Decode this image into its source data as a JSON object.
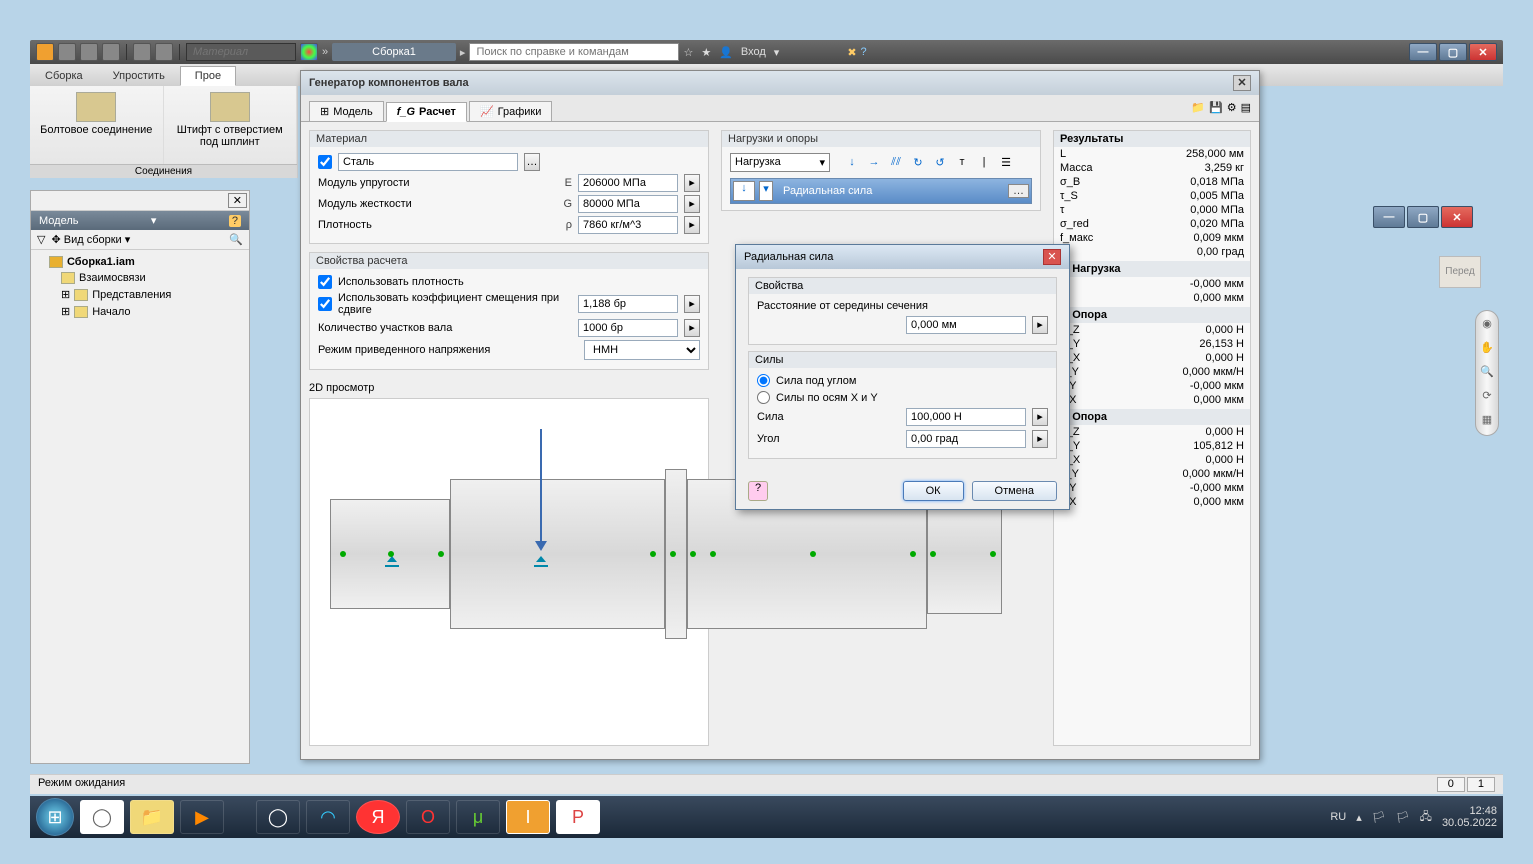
{
  "top": {
    "material_placeholder": "Материал",
    "doc_tab": "Сборка1",
    "search_placeholder": "Поиск по справке и командам",
    "login": "Вход"
  },
  "ribbon_tabs": [
    "Сборка",
    "Упростить",
    "Прое"
  ],
  "ribbon_items": {
    "bolt": "Болтовое соединение",
    "pin": "Штифт с отверстием под шплинт",
    "group": "Соединения"
  },
  "model_panel": {
    "title": "Модель",
    "filter": "Вид сборки",
    "root": "Сборка1.iam",
    "nodes": [
      "Взаимосвязи",
      "Представления",
      "Начало"
    ]
  },
  "gen": {
    "title": "Генератор компонентов вала",
    "tabs": {
      "model": "Модель",
      "calc": "Расчет",
      "graphs": "Графики"
    },
    "material": {
      "group": "Материал",
      "name": "Сталь",
      "e_label": "Модуль упругости",
      "e_sym": "E",
      "e_val": "206000 МПа",
      "g_label": "Модуль жесткости",
      "g_sym": "G",
      "g_val": "80000 МПа",
      "rho_label": "Плотность",
      "rho_sym": "ρ",
      "rho_val": "7860 кг/м^3"
    },
    "calc_props": {
      "group": "Свойства расчета",
      "use_density": "Использовать плотность",
      "use_shear": "Использовать коэффициент смещения при сдвиге",
      "shear_val": "1,188 бр",
      "sections_label": "Количество участков вала",
      "sections_val": "1000 бр",
      "mode_label": "Режим приведенного напряжения",
      "mode_val": "НМН"
    },
    "loads": {
      "group": "Нагрузки и опоры",
      "dd": "Нагрузка",
      "item": "Радиальная сила"
    },
    "preview_title": "2D просмотр"
  },
  "results": {
    "header": "Результаты",
    "rows": [
      [
        "L",
        "258,000 мм"
      ],
      [
        "Масса",
        "3,259 кг"
      ],
      [
        "σ_B",
        "0,018 МПа"
      ],
      [
        "τ_S",
        "0,005 МПа"
      ],
      [
        "τ",
        "0,000 МПа"
      ],
      [
        "σ_red",
        "0,020 МПа"
      ],
      [
        "f_макс",
        "0,009 мкм"
      ],
      [
        "",
        "0,00 град"
      ]
    ],
    "s1": "1. Нагрузка",
    "s1rows": [
      [
        "",
        "-0,000 мкм"
      ],
      [
        "",
        "0,000 мкм"
      ]
    ],
    "s2": "1. Опора",
    "s2rows": [
      [
        "F_Z",
        "0,000 Н"
      ],
      [
        "F_Y",
        "26,153 Н"
      ],
      [
        "F_X",
        "0,000 Н"
      ],
      [
        "γ_Y",
        "0,000 мкм/Н"
      ],
      [
        "f_Y",
        "-0,000 мкм"
      ],
      [
        "f_X",
        "0,000 мкм"
      ]
    ],
    "s3": "2. Опора",
    "s3rows": [
      [
        "F_Z",
        "0,000 Н"
      ],
      [
        "F_Y",
        "105,812 Н"
      ],
      [
        "F_X",
        "0,000 Н"
      ],
      [
        "γ_Y",
        "0,000 мкм/Н"
      ],
      [
        "f_Y",
        "-0,000 мкм"
      ],
      [
        "f_X",
        "0,000 мкм"
      ]
    ]
  },
  "dialog": {
    "title": "Радиальная сила",
    "props": "Свойства",
    "dist_label": "Расстояние от середины сечения",
    "dist_val": "0,000 мм",
    "forces": "Силы",
    "r1": "Сила под углом",
    "r2": "Силы по осям X и Y",
    "force_label": "Сила",
    "force_val": "100,000 Н",
    "angle_label": "Угол",
    "angle_val": "0,00 град",
    "ok": "ОК",
    "cancel": "Отмена"
  },
  "status": {
    "text": "Режим ожидания",
    "coords": [
      "0",
      "1"
    ]
  },
  "viewcube": "Перед",
  "tray": {
    "lang": "RU",
    "time": "12:48",
    "date": "30.05.2022"
  }
}
